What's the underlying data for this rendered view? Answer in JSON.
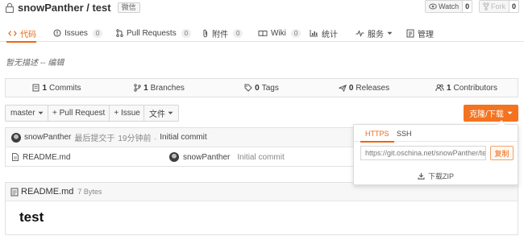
{
  "header": {
    "repo_title": "snowPanther / test",
    "badge": "微信",
    "watch_label": "Watch",
    "watch_count": "0",
    "fork_label": "Fork",
    "fork_count": "0"
  },
  "tabs": [
    {
      "label": "代码",
      "icon": "code-icon"
    },
    {
      "label": "Issues",
      "count": "0",
      "icon": "issue-icon"
    },
    {
      "label": "Pull Requests",
      "count": "0",
      "icon": "pull-request-icon"
    },
    {
      "label": "附件",
      "count": "0",
      "icon": "paperclip-icon"
    },
    {
      "label": "Wiki",
      "count": "0",
      "icon": "book-icon"
    },
    {
      "label": "统计",
      "icon": "stats-icon"
    },
    {
      "label": "服务",
      "icon": "pulse-icon"
    },
    {
      "label": "管理",
      "icon": "settings-doc-icon"
    }
  ],
  "description": "暂无描述 -- 编辑",
  "stats": [
    {
      "count": "1",
      "label": "Commits"
    },
    {
      "count": "1",
      "label": "Branches"
    },
    {
      "count": "0",
      "label": "Tags"
    },
    {
      "count": "0",
      "label": "Releases"
    },
    {
      "count": "1",
      "label": "Contributors"
    }
  ],
  "actions": {
    "branch": "master",
    "pull_request": "+ Pull Request",
    "issue": "+ Issue",
    "file": "文件",
    "clone": "克隆/下载"
  },
  "last_commit": {
    "author": "snowPanther",
    "info": "最后提交于",
    "time": "19分钟前",
    "message": "Initial commit"
  },
  "files": [
    {
      "name": "README.md",
      "author": "snowPanther",
      "message": "Initial commit"
    }
  ],
  "readme": {
    "title": "README.md",
    "size": "7 Bytes",
    "heading": "test"
  },
  "clone_popover": {
    "tab_https": "HTTPS",
    "tab_ssh": "SSH",
    "url": "https://git.oschina.net/snowPanther/test.git",
    "copy_label": "复制",
    "zip_label": "下载ZIP"
  },
  "colors": {
    "accent": "#ee6611",
    "clone_button": "#f4731f"
  }
}
